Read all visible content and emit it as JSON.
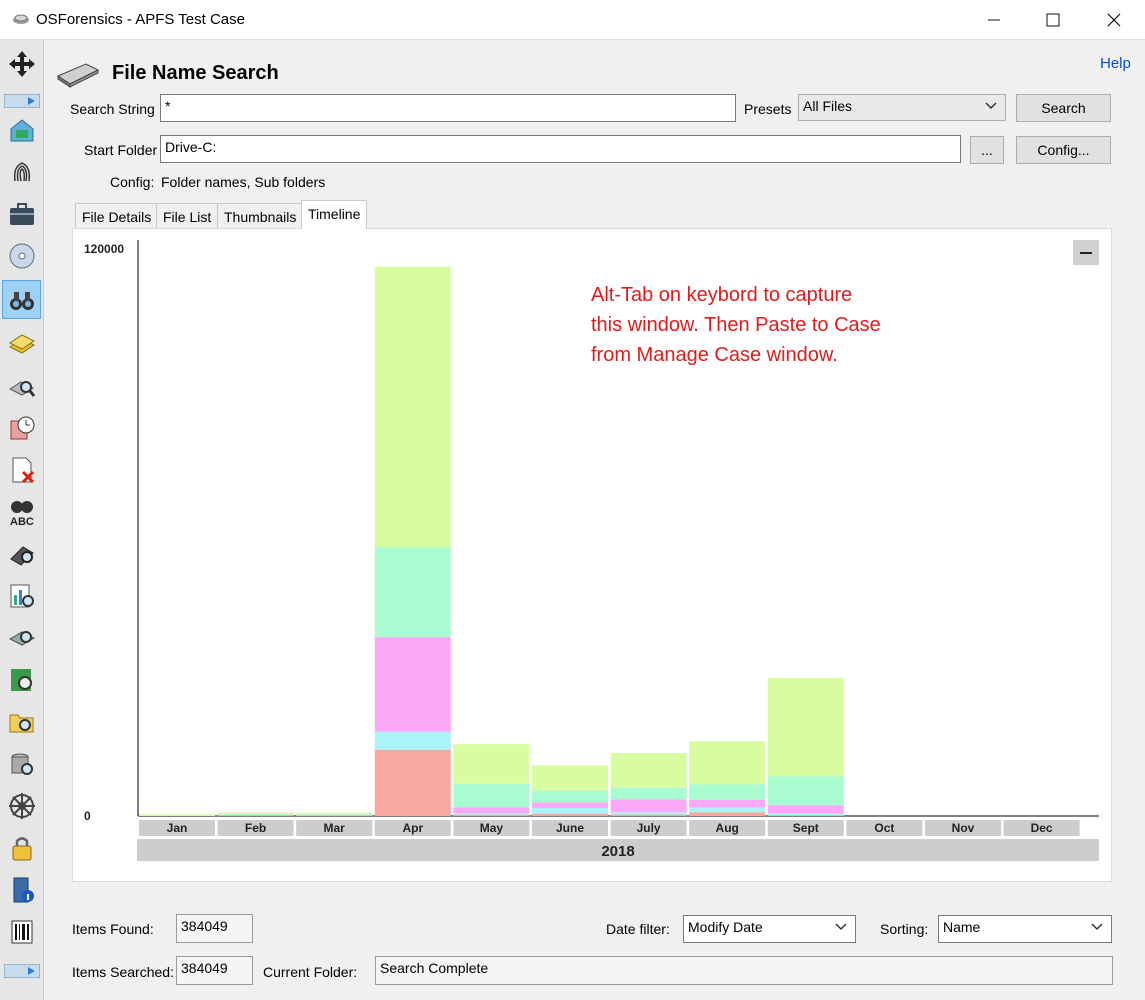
{
  "window": {
    "title": "OSForensics - APFS Test Case",
    "controls": [
      "minimize-icon",
      "maximize-icon",
      "close-icon"
    ]
  },
  "sidebar": {
    "items": [
      {
        "name": "navigate-icon"
      },
      {
        "name": "workflow-icon"
      },
      {
        "name": "fingerprint-icon"
      },
      {
        "name": "case-briefcase-icon"
      },
      {
        "name": "disk-icon"
      },
      {
        "name": "binoculars-icon",
        "active": true
      },
      {
        "name": "database-icon"
      },
      {
        "name": "drive-search-icon"
      },
      {
        "name": "recent-activity-icon"
      },
      {
        "name": "deleted-files-icon"
      },
      {
        "name": "abc-search-icon"
      },
      {
        "name": "password-recovery-icon"
      },
      {
        "name": "chart-search-icon"
      },
      {
        "name": "memory-viewer-icon"
      },
      {
        "name": "mismatch-search-icon"
      },
      {
        "name": "folder-search-icon"
      },
      {
        "name": "raw-disk-icon"
      },
      {
        "name": "registry-icon"
      },
      {
        "name": "lock-icon"
      },
      {
        "name": "system-info-icon"
      },
      {
        "name": "barcode-icon"
      }
    ]
  },
  "header": {
    "title": "File Name Search",
    "help": "Help"
  },
  "form": {
    "search_string_label": "Search String",
    "search_string_value": "*",
    "presets_label": "Presets",
    "presets_value": "All Files",
    "search_button": "Search",
    "start_folder_label": "Start Folder",
    "start_folder_value": "Drive-C:",
    "browse_button": "...",
    "config_button": "Config...",
    "config_label": "Config:",
    "config_value": "Folder names, Sub folders"
  },
  "tabs": [
    {
      "label": "File Details"
    },
    {
      "label": "File List"
    },
    {
      "label": "Thumbnails"
    },
    {
      "label": "Timeline",
      "active": true
    }
  ],
  "annotation": {
    "line1": "Alt-Tab on keybord to capture",
    "line2": "this window. Then Paste to Case",
    "line3": "from Manage Case window."
  },
  "chart_data": {
    "type": "bar",
    "stacked": true,
    "categories": [
      "Jan",
      "Feb",
      "Mar",
      "Apr",
      "May",
      "June",
      "July",
      "Aug",
      "Sept",
      "Oct",
      "Nov",
      "Dec"
    ],
    "group_label": "2018",
    "y_ticks": [
      "120000",
      "0"
    ],
    "ylim": [
      0,
      120000
    ],
    "colors": [
      "#f8a8a0",
      "#a8f4f8",
      "#fca8f8",
      "#a8fcd0",
      "#d8fca0"
    ],
    "series": [
      {
        "values": [
          0,
          200,
          100,
          14000,
          300,
          500,
          300,
          800,
          200,
          0,
          0,
          0
        ]
      },
      {
        "values": [
          0,
          100,
          100,
          3800,
          300,
          1200,
          500,
          1000,
          300,
          0,
          0,
          0
        ]
      },
      {
        "values": [
          0,
          0,
          0,
          20000,
          1200,
          1200,
          2700,
          1600,
          1800,
          0,
          0,
          0
        ]
      },
      {
        "values": [
          0,
          100,
          200,
          19000,
          5000,
          2500,
          2500,
          3300,
          6100,
          0,
          0,
          0
        ]
      },
      {
        "values": [
          400,
          300,
          300,
          59300,
          8400,
          5300,
          7300,
          9100,
          20800,
          0,
          0,
          0
        ]
      }
    ]
  },
  "footer": {
    "items_found_label": "Items Found:",
    "items_found_value": "384049",
    "items_searched_label": "Items Searched:",
    "items_searched_value": "384049",
    "current_folder_label": "Current Folder:",
    "current_folder_value": "Search Complete",
    "date_filter_label": "Date filter:",
    "date_filter_value": "Modify Date",
    "sorting_label": "Sorting:",
    "sorting_value": "Name"
  }
}
